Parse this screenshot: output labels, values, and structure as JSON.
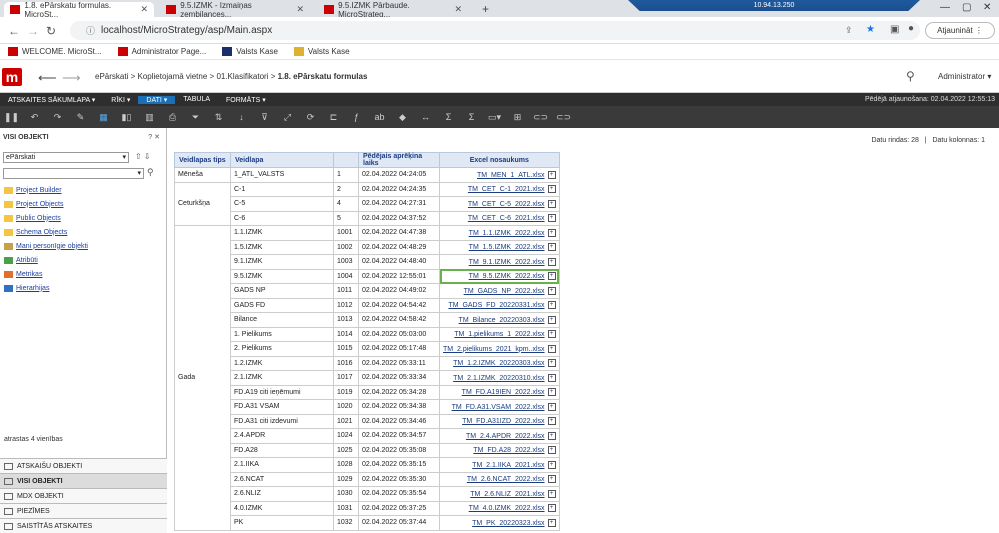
{
  "browser": {
    "tabs": [
      {
        "label": "1.8. ePārskatu formulas. MicroSt...",
        "active": true
      },
      {
        "label": "9.5.IZMK - Izmaiņas zembilances...",
        "active": false
      },
      {
        "label": "9.5.IZMK Pārbaude. MicroStrateg...",
        "active": false
      }
    ],
    "remote_host": "10.94.13.250",
    "url": "localhost/MicroStrategy/asp/Main.aspx",
    "update_label": "Atjaunināt",
    "bookmarks": [
      "WELCOME. MicroSt...",
      "Administrator Page...",
      "Valsts Kase",
      "Valsts Kase"
    ]
  },
  "header": {
    "breadcrumb": [
      "ePārskati",
      "Koplietojamā vietne",
      "01.Klasifikatori"
    ],
    "breadcrumb_current": "1.8. ePārskatu formulas",
    "user": "Administrator"
  },
  "menu": {
    "items": [
      "ATSKAITES SĀKUMLAPA",
      "RĪKI",
      "DATI",
      "TABULA",
      "FORMĀTS"
    ],
    "active": "DATI",
    "last_update": "Pēdējā atjaunošana: 02.04.2022 12:55:13"
  },
  "left": {
    "title": "VISI OBJEKTI",
    "controls": "? ✕",
    "select_value": "ePārskati",
    "tree": [
      {
        "label": "Project Builder",
        "icon": "folder-icon"
      },
      {
        "label": "Project Objects",
        "icon": "folder-icon"
      },
      {
        "label": "Public Objects",
        "icon": "folder-icon"
      },
      {
        "label": "Schema Objects",
        "icon": "folder-icon"
      },
      {
        "label": "Mani personīgie objekti",
        "icon": "user-folder-icon"
      },
      {
        "label": "Atribūti",
        "icon": "attribute-icon"
      },
      {
        "label": "Metrikas",
        "icon": "metric-icon"
      },
      {
        "label": "Hierarhijas",
        "icon": "hierarchy-icon"
      }
    ],
    "found": "atrastas 4 vienības",
    "nav": [
      "ATSKAIŠU OBJEKTI",
      "VISI OBJEKTI",
      "MDX OBJEKTI",
      "PIEZĪMES",
      "SAISTĪTĀS ATSKAITES"
    ],
    "nav_active": "VISI OBJEKTI"
  },
  "main": {
    "rows_label": "Datu rindas: 28",
    "cols_label": "Datu kolonnas: 1",
    "columns": [
      "Veidlapas tips",
      "Veidlapa",
      "",
      "Pēdējais aprēķina laiks",
      "Excel nosaukums"
    ],
    "groups": [
      {
        "type": "Mēneša",
        "rows": [
          [
            "1_ATL_VALSTS",
            "1",
            "02.04.2022 04:24:05",
            "TM_MEN_1_ATL.xlsx"
          ]
        ]
      },
      {
        "type": "Ceturkšņa",
        "rows": [
          [
            "C-1",
            "2",
            "02.04.2022 04:24:35",
            "TM_CET_C-1_2021.xlsx"
          ],
          [
            "C-5",
            "4",
            "02.04.2022 04:27:31",
            "TM_CET_C-5_2022.xlsx"
          ],
          [
            "C-6",
            "5",
            "02.04.2022 04:37:52",
            "TM_CET_C-6_2021.xlsx"
          ]
        ]
      },
      {
        "type": "Gada",
        "rows": [
          [
            "1.1.IZMK",
            "1001",
            "02.04.2022 04:47:38",
            "TM_1.1.IZMK_2022.xlsx"
          ],
          [
            "1.5.IZMK",
            "1002",
            "02.04.2022 04:48:29",
            "TM_1.5.IZMK_2022.xlsx"
          ],
          [
            "9.1.IZMK",
            "1003",
            "02.04.2022 04:48:40",
            "TM_9.1.IZMK_2022.xlsx"
          ],
          [
            "9.5.IZMK",
            "1004",
            "02.04.2022 12:55:01",
            "TM_9.5.IZMK_2022.xlsx"
          ],
          [
            "GADS NP",
            "1011",
            "02.04.2022 04:49:02",
            "TM_GADS_NP_2022.xlsx"
          ],
          [
            "GADS FD",
            "1012",
            "02.04.2022 04:54:42",
            "TM_GADS_FD_20220331.xlsx"
          ],
          [
            "Bilance",
            "1013",
            "02.04.2022 04:58:42",
            "TM_Bilance_20220303.xlsx"
          ],
          [
            "1. Pielikums",
            "1014",
            "02.04.2022 05:03:00",
            "TM_1.pielikums_1_2022.xlsx"
          ],
          [
            "2. Pielikums",
            "1015",
            "02.04.2022 05:17:48",
            "TM_2.pielikums_2021_kpm..xlsx"
          ],
          [
            "1.2.IZMK",
            "1016",
            "02.04.2022 05:33:11",
            "TM_1.2.IZMK_20220303.xlsx"
          ],
          [
            "2.1.IZMK",
            "1017",
            "02.04.2022 05:33:34",
            "TM_2.1.IZMK_20220310.xlsx"
          ],
          [
            "FD.A19 citi ieņēmumi",
            "1019",
            "02.04.2022 05:34:28",
            "TM_FD.A19IEN_2022.xlsx"
          ],
          [
            "FD.A31 VSAM",
            "1020",
            "02.04.2022 05:34:38",
            "TM_FD.A31.VSAM_2022.xlsx"
          ],
          [
            "FD.A31 citi izdevumi",
            "1021",
            "02.04.2022 05:34:46",
            "TM_FD.A31IZD_2022.xlsx"
          ],
          [
            "2.4.APDR",
            "1024",
            "02.04.2022 05:34:57",
            "TM_2.4.APDR_2022.xlsx"
          ],
          [
            "FD.A28",
            "1025",
            "02.04.2022 05:35:08",
            "TM_FD.A28_2022.xlsx"
          ],
          [
            "2.1.IIKA",
            "1028",
            "02.04.2022 05:35:15",
            "TM_2.1.IIKA_2021.xlsx"
          ],
          [
            "2.6.NCAT",
            "1029",
            "02.04.2022 05:35:30",
            "TM_2.6.NCAT_2022.xlsx"
          ],
          [
            "2.6.NLIZ",
            "1030",
            "02.04.2022 05:35:54",
            "TM_2.6.NLIZ_2021.xlsx"
          ],
          [
            "4.0.IZMK",
            "1031",
            "02.04.2022 05:37:25",
            "TM_4.0.IZMK_2022.xlsx"
          ],
          [
            "PK",
            "1032",
            "02.04.2022 05:37:44",
            "TM_PK_20220323.xlsx"
          ]
        ]
      }
    ],
    "highlighted_file": "TM_9.5.IZMK_2022.xlsx"
  }
}
